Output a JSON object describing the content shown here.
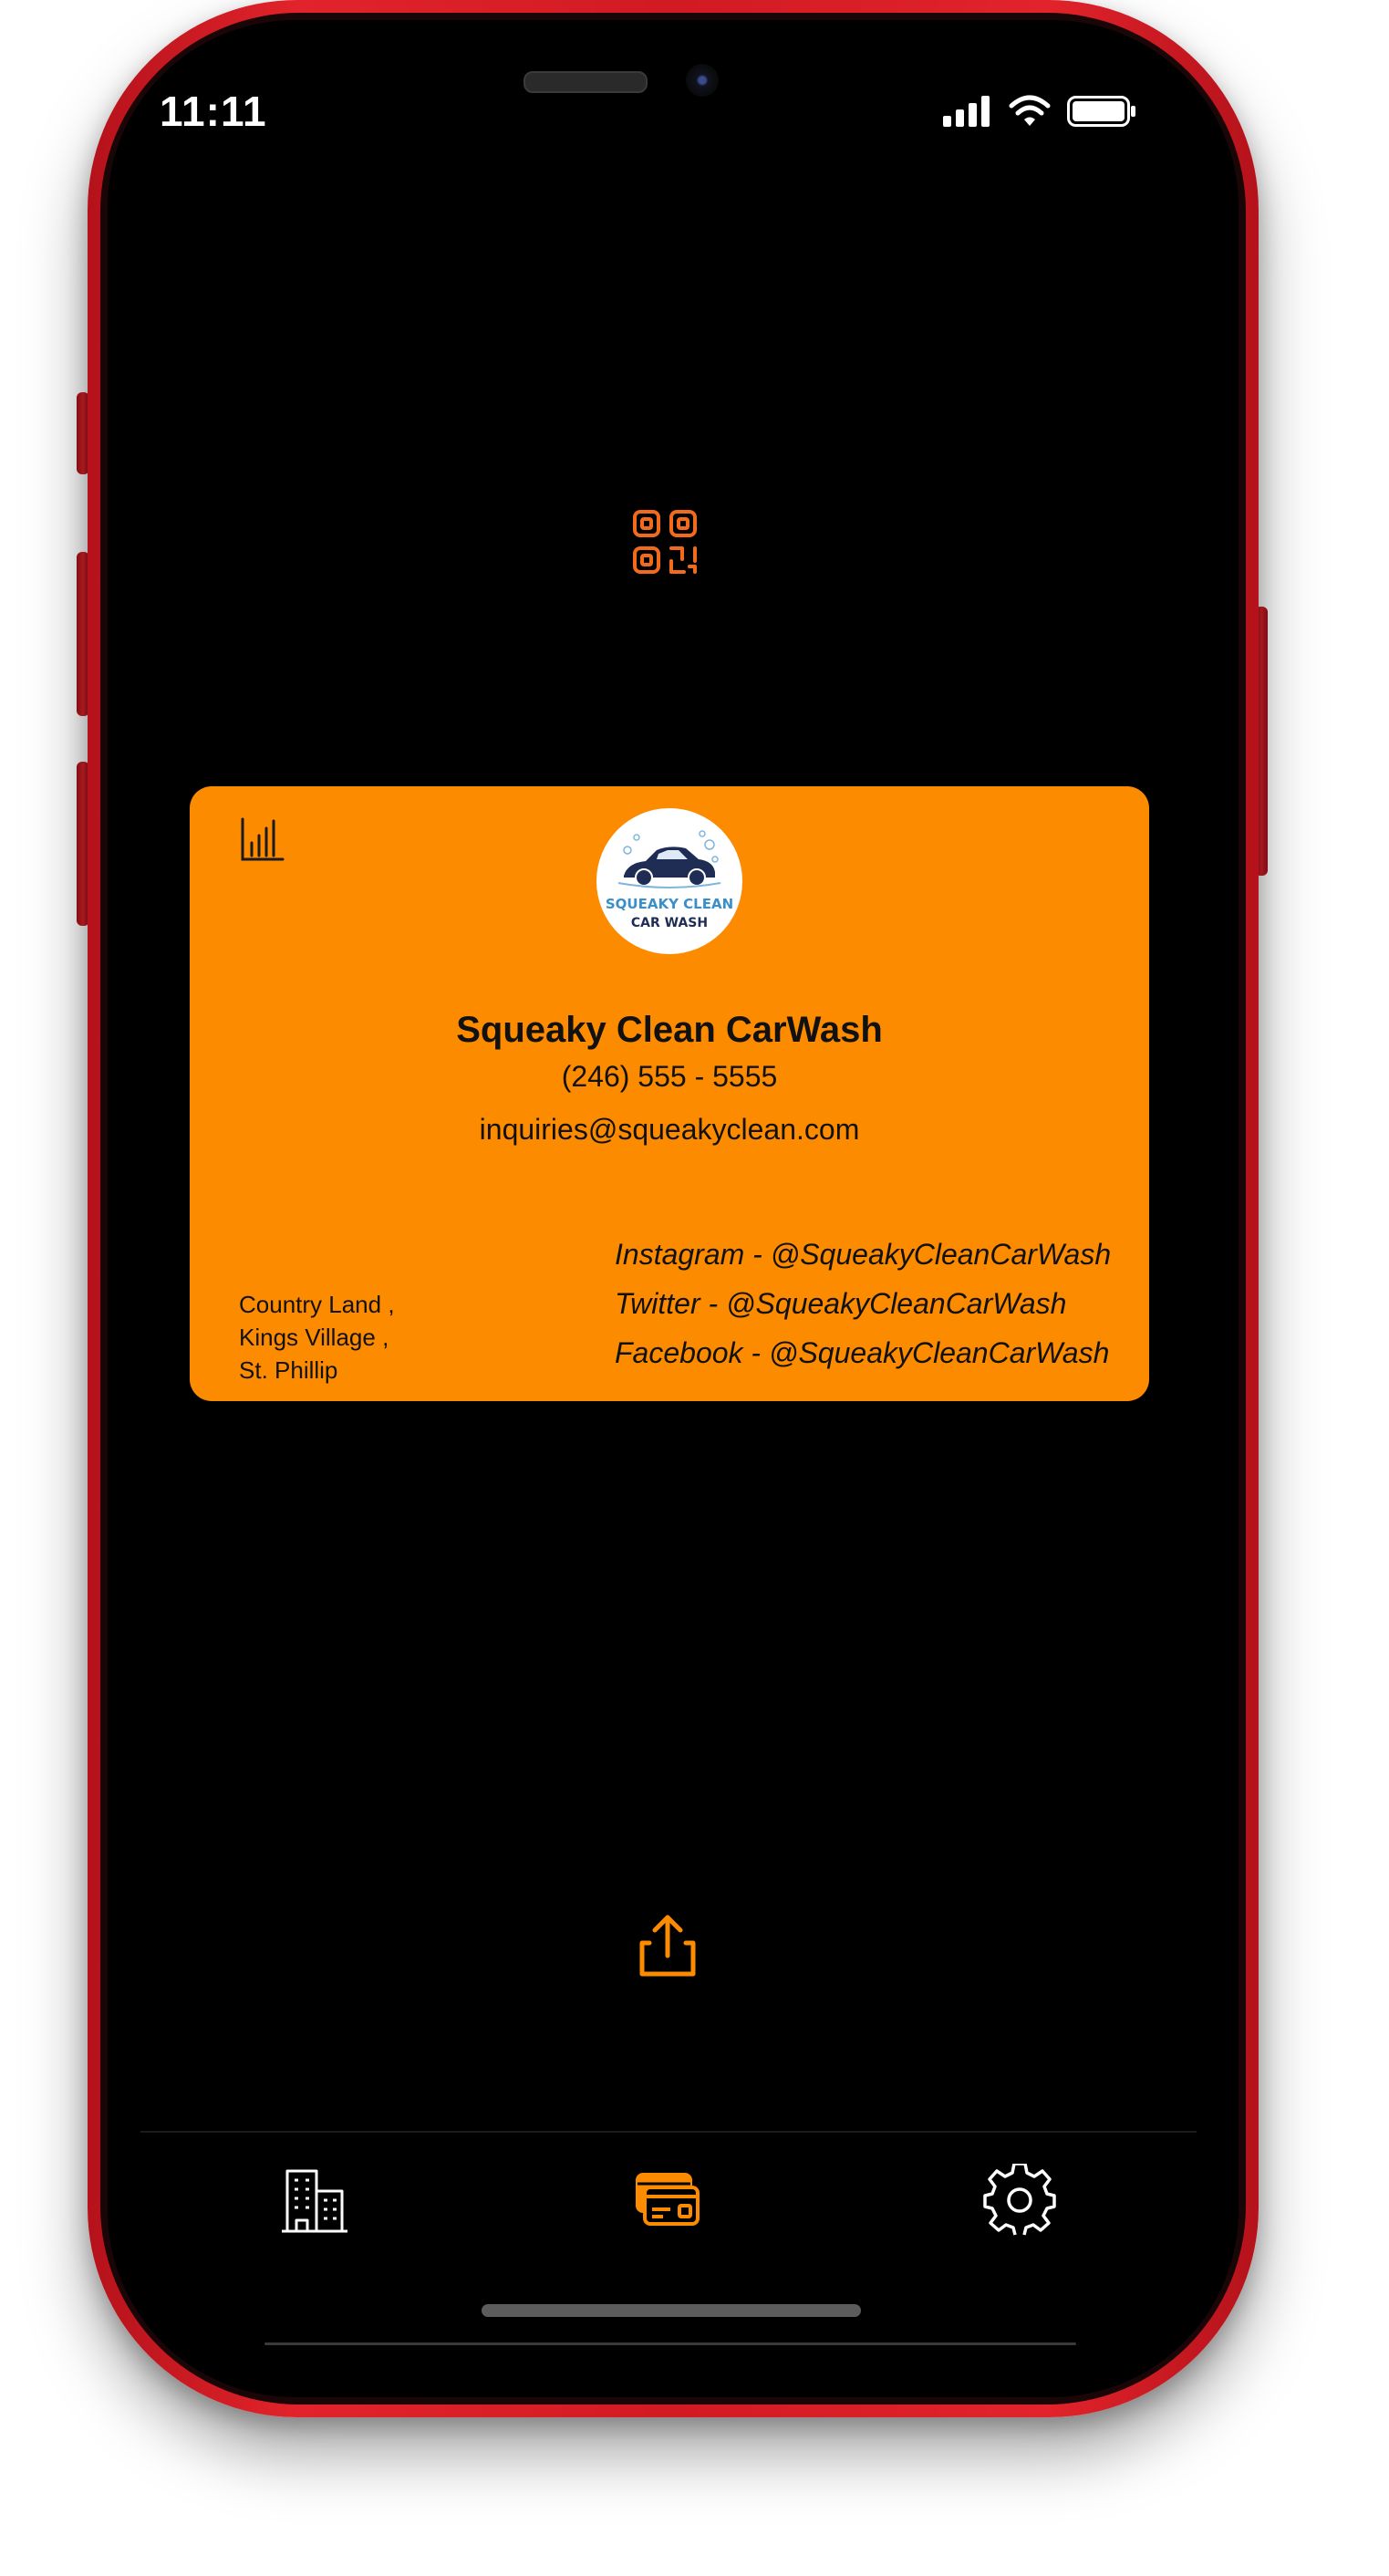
{
  "status_bar": {
    "time": "11:11",
    "icons": [
      "cellular-signal-icon",
      "wifi-icon",
      "battery-icon"
    ]
  },
  "top_action": {
    "icon": "qr-code-icon"
  },
  "card": {
    "background_color": "#fd8b00",
    "analytics_icon": "bar-chart-icon",
    "logo": {
      "line1": "SQUEAKY CLEAN",
      "line2": "CAR WASH"
    },
    "business_name": "Squeaky Clean CarWash",
    "phone": "(246) 555 - 5555",
    "email": "inquiries@squeakyclean.com",
    "address": {
      "line1": "Country Land ,",
      "line2": "Kings Village ,",
      "line3": "St. Phillip"
    },
    "socials": {
      "instagram": "Instagram - @SqueakyCleanCarWash",
      "twitter": "Twitter - @SqueakyCleanCarWash",
      "facebook": "Facebook - @SqueakyCleanCarWash"
    }
  },
  "share_action": {
    "icon": "share-icon"
  },
  "tab_bar": {
    "tabs": [
      {
        "icon": "buildings-icon",
        "selected": false
      },
      {
        "icon": "business-cards-icon",
        "selected": true
      },
      {
        "icon": "settings-gear-icon",
        "selected": false
      }
    ]
  },
  "colors": {
    "accent": "#fd8b00",
    "phone_frame": "#d21a22",
    "screen": "#000000"
  }
}
